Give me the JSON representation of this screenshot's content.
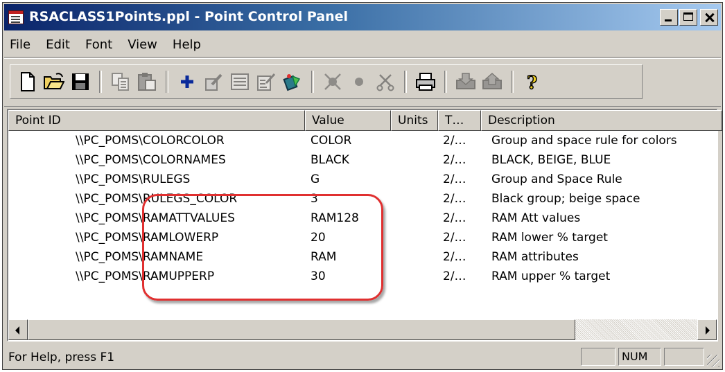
{
  "window": {
    "title": "RSACLASS1Points.ppl - Point Control Panel"
  },
  "menu": [
    "File",
    "Edit",
    "Font",
    "View",
    "Help"
  ],
  "toolbar": {
    "buttons": [
      {
        "icon": "new-document-icon"
      },
      {
        "icon": "open-folder-icon"
      },
      {
        "icon": "save-disk-icon"
      },
      {
        "icon": "copy-icon"
      },
      {
        "icon": "paste-icon"
      },
      {
        "icon": "add-point-plus-icon"
      },
      {
        "icon": "edit-point-icon"
      },
      {
        "icon": "point-list-icon"
      },
      {
        "icon": "point-properties-icon"
      },
      {
        "icon": "refresh-points-icon"
      },
      {
        "icon": "disconnect-icon"
      },
      {
        "icon": "record-dot-icon"
      },
      {
        "icon": "cut-icon"
      },
      {
        "icon": "print-icon"
      },
      {
        "icon": "import-icon"
      },
      {
        "icon": "export-icon"
      },
      {
        "icon": "help-question-icon"
      }
    ]
  },
  "list": {
    "columns": [
      "Point ID",
      "Value",
      "Units",
      "T…",
      "Description"
    ],
    "rows": [
      {
        "id": "\\\\PC_POMS\\COLORCOLOR",
        "value": "COLOR",
        "units": "",
        "time": "2/…",
        "description": "Group and space rule for colors"
      },
      {
        "id": "\\\\PC_POMS\\COLORNAMES",
        "value": "BLACK",
        "units": "",
        "time": "2/…",
        "description": "BLACK, BEIGE, BLUE"
      },
      {
        "id": "\\\\PC_POMS\\RULEGS",
        "value": "G",
        "units": "",
        "time": "2/…",
        "description": "Group and Space Rule"
      },
      {
        "id": "\\\\PC_POMS\\RULEGS_COLOR",
        "value": "3",
        "units": "",
        "time": "2/…",
        "description": "Black group; beige space"
      },
      {
        "id": "\\\\PC_POMS\\RAMATTVALUES",
        "value": "RAM128",
        "units": "",
        "time": "2/…",
        "description": "RAM Att values"
      },
      {
        "id": "\\\\PC_POMS\\RAMLOWERP",
        "value": "20",
        "units": "",
        "time": "2/…",
        "description": "RAM lower % target"
      },
      {
        "id": "\\\\PC_POMS\\RAMNAME",
        "value": "RAM",
        "units": "",
        "time": "2/…",
        "description": "RAM attributes"
      },
      {
        "id": "\\\\PC_POMS\\RAMUPPERP",
        "value": "30",
        "units": "",
        "time": "2/…",
        "description": "RAM upper % target"
      }
    ]
  },
  "status": {
    "text": "For Help, press F1",
    "panels": [
      "",
      "NUM",
      ""
    ]
  },
  "colors": {
    "title_gradient_start": "#0a246a",
    "title_gradient_end": "#a6caf0",
    "highlight": "#e03030",
    "chrome": "#d4d0c8"
  }
}
